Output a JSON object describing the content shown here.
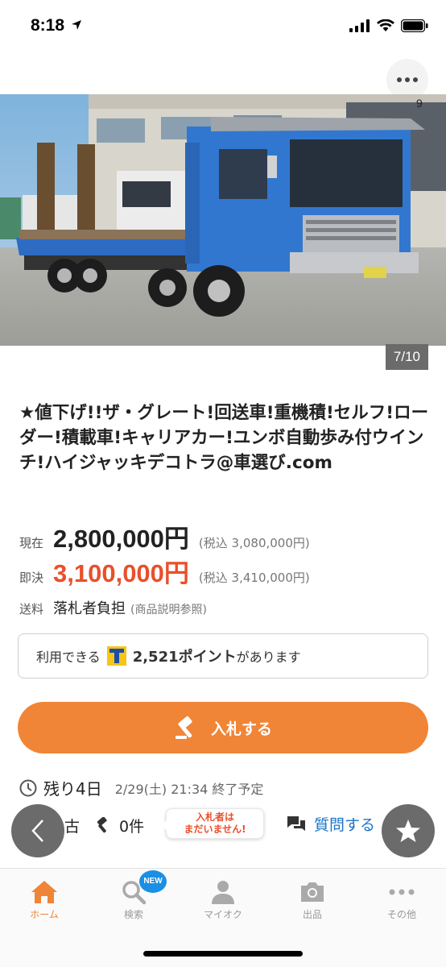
{
  "status_bar": {
    "time": "8:18"
  },
  "photo": {
    "counter": "7/10"
  },
  "title": "★値下げ!!ザ・グレート!回送車!重機積!セルフ!ローダー!積載車!キャリアカー!ユンボ自動歩み付ウインチ!ハイジャッキデコトラ@車選び.com",
  "prices": {
    "current_label": "現在",
    "current_value": "2,800,000円",
    "current_tax": "(税込 3,080,000円)",
    "buynow_label": "即決",
    "buynow_value": "3,100,000円",
    "buynow_tax": "(税込 3,410,000円)"
  },
  "shipping": {
    "label": "送料",
    "value": "落札者負担",
    "note": "(商品説明参照)"
  },
  "points": {
    "prefix": "利用できる",
    "amount": "2,521ポイント",
    "suffix": "があります"
  },
  "bid_button": {
    "label": "入札する"
  },
  "remaining": {
    "main": "残り4日",
    "end": "2/29(土) 21:34 終了予定"
  },
  "info": {
    "condition": "古",
    "bid_count": "0件",
    "bubble_line1": "入札者は",
    "bubble_line2": "まだいません!",
    "ask_label": "質問する"
  },
  "tabs": [
    {
      "label": "ホーム",
      "icon": "home-icon",
      "active": true
    },
    {
      "label": "検索",
      "icon": "search-icon",
      "badge": "NEW"
    },
    {
      "label": "マイオク",
      "icon": "person-icon"
    },
    {
      "label": "出品",
      "icon": "camera-icon"
    },
    {
      "label": "その他",
      "icon": "more-icon"
    }
  ],
  "colors": {
    "accent": "#f08537",
    "price_red": "#e8502b",
    "link_blue": "#1a73c8",
    "badge_blue": "#1a8fe3"
  }
}
